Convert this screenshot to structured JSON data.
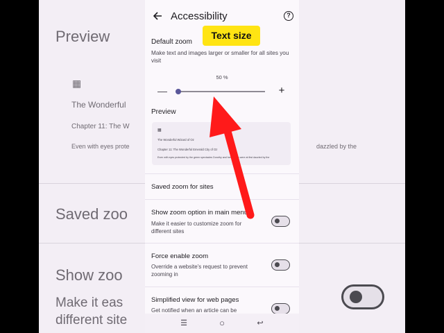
{
  "backdrop": {
    "left_preview": "Preview",
    "left_book_title": "The Wonderful",
    "left_chapter": "Chapter 11: The W",
    "left_body": "Even with eyes prote",
    "left_saved_zoom": "Saved zoo",
    "left_show_zoom": "Show zoo",
    "left_make_it": "Make it eas",
    "left_different": "different site",
    "right_body": "dazzled by the"
  },
  "appbar": {
    "title": "Accessibility",
    "back_icon": "arrow-left-icon",
    "help_icon": "help-circle-icon",
    "help_glyph": "?"
  },
  "overlay": {
    "badge_label": "Text size",
    "badge_color": "#ffe413",
    "arrow_color": "#ff1a1a"
  },
  "default_zoom": {
    "title": "Default zoom",
    "description": "Make text and images larger or smaller for all sites you visit",
    "percent_label": "50 %",
    "minus_glyph": "—",
    "plus_glyph": "+",
    "value_fraction": 0.0
  },
  "preview": {
    "title": "Preview",
    "book_title": "The Wonderful Wizard of Oz",
    "chapter": "Chapter 11: The Wonderful Emerald City of Oz",
    "body": "Even with eyes protected by the green spectacles Dorothy and her friends were at first dazzled by the"
  },
  "saved_zoom": {
    "title": "Saved zoom for sites"
  },
  "settings": [
    {
      "title": "Show zoom option in main menu",
      "description": "Make it easier to customize zoom for different sites",
      "enabled": false
    },
    {
      "title": "Force enable zoom",
      "description": "Override a website's request to prevent zooming in",
      "enabled": false
    },
    {
      "title": "Simplified view for web pages",
      "description": "Get notified when an article can be",
      "enabled": false
    }
  ],
  "navbar": {
    "recents_glyph": "☰",
    "home_glyph": "○",
    "back_glyph": "↩"
  }
}
